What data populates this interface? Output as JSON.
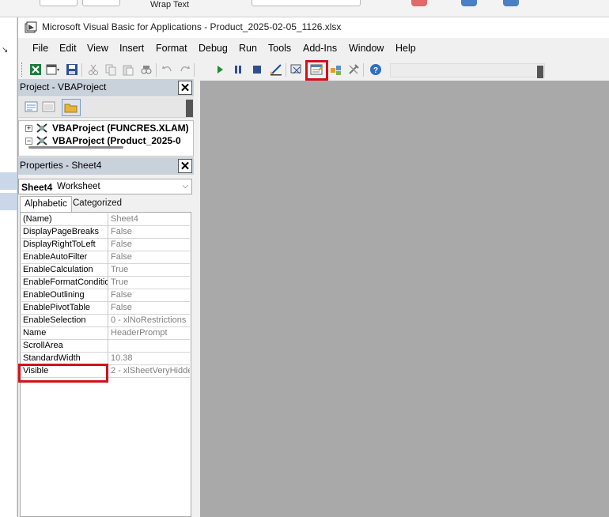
{
  "excel_background": {
    "top_label": "Wrap Text",
    "ribbon_icon_colors": [
      "#e06a6a",
      "#4a7fc1",
      "#4a7fc1"
    ]
  },
  "window": {
    "title": "Microsoft Visual Basic for Applications - Product_2025-02-05_1126.xlsx",
    "icon": "vba-app-icon"
  },
  "menu": {
    "items": [
      {
        "label": "File",
        "key": "file"
      },
      {
        "label": "Edit",
        "key": "edit"
      },
      {
        "label": "View",
        "key": "view"
      },
      {
        "label": "Insert",
        "key": "insert"
      },
      {
        "label": "Format",
        "key": "format"
      },
      {
        "label": "Debug",
        "key": "debug"
      },
      {
        "label": "Run",
        "key": "run"
      },
      {
        "label": "Tools",
        "key": "tools"
      },
      {
        "label": "Add-Ins",
        "key": "addins"
      },
      {
        "label": "Window",
        "key": "window"
      },
      {
        "label": "Help",
        "key": "help"
      }
    ]
  },
  "toolbar": {
    "buttons": [
      "view-excel-icon",
      "insert-module-icon",
      "save-icon",
      "cut-icon",
      "copy-icon",
      "paste-icon",
      "find-icon",
      "undo-icon",
      "redo-icon",
      "run-icon",
      "break-icon",
      "reset-icon",
      "design-mode-icon",
      "project-explorer-icon",
      "properties-window-icon",
      "object-browser-icon",
      "toolbox-icon",
      "help-icon"
    ],
    "highlighted": "properties-window-icon",
    "accent_color": "#d0121b"
  },
  "project_panel": {
    "title": "Project - VBAProject",
    "close_symbol": "✕",
    "tree": [
      {
        "label": "VBAProject (FUNCRES.XLAM)"
      },
      {
        "label": "VBAProject (Product_2025-0"
      }
    ]
  },
  "properties_panel": {
    "title": "Properties - Sheet4",
    "close_symbol": "✕",
    "object_name": "Sheet4",
    "object_type": "Worksheet",
    "tabs": {
      "alphabetic": "Alphabetic",
      "categorized": "Categorized"
    },
    "rows": [
      {
        "name": "(Name)",
        "value": "Sheet4"
      },
      {
        "name": "DisplayPageBreaks",
        "value": "False"
      },
      {
        "name": "DisplayRightToLeft",
        "value": "False"
      },
      {
        "name": "EnableAutoFilter",
        "value": "False"
      },
      {
        "name": "EnableCalculation",
        "value": "True"
      },
      {
        "name": "EnableFormatConditio",
        "value": "True"
      },
      {
        "name": "EnableOutlining",
        "value": "False"
      },
      {
        "name": "EnablePivotTable",
        "value": "False"
      },
      {
        "name": "EnableSelection",
        "value": "0 - xlNoRestrictions"
      },
      {
        "name": "Name",
        "value": "HeaderPrompt"
      },
      {
        "name": "ScrollArea",
        "value": ""
      },
      {
        "name": "StandardWidth",
        "value": "10.38"
      },
      {
        "name": "Visible",
        "value": "2 - xlSheetVeryHidde"
      }
    ],
    "highlighted_row": "Visible"
  },
  "workspace_color": "#a9a9a9"
}
